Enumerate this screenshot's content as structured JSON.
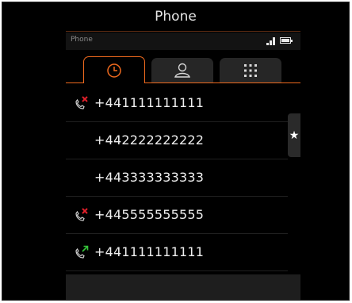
{
  "header": {
    "title": "Phone"
  },
  "status": {
    "app_label": "Phone"
  },
  "tabs": [
    {
      "name": "recent",
      "icon": "clock-icon",
      "active": true
    },
    {
      "name": "contacts",
      "icon": "person-icon",
      "active": false
    },
    {
      "name": "keypad",
      "icon": "keypad-icon",
      "active": false
    }
  ],
  "calls": [
    {
      "number": "+441111111111",
      "type": "missed",
      "icon": "missed-call-icon"
    },
    {
      "number": "+442222222222",
      "type": "none",
      "icon": ""
    },
    {
      "number": "+443333333333",
      "type": "none",
      "icon": ""
    },
    {
      "number": "+445555555555",
      "type": "missed",
      "icon": "missed-call-icon"
    },
    {
      "number": "+441111111111",
      "type": "outgoing",
      "icon": "outgoing-call-icon"
    }
  ],
  "favorites_tab": {
    "glyph": "★"
  },
  "colors": {
    "accent": "#f06a1e",
    "missed": "#e0202a",
    "outgoing": "#35c43a"
  }
}
